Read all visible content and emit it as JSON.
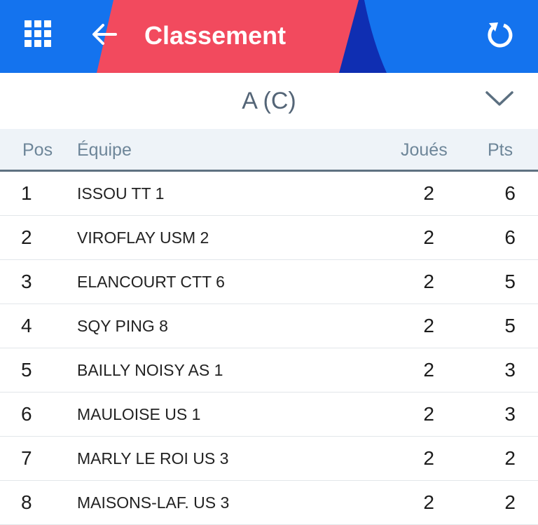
{
  "header": {
    "title": "Classement",
    "background_color": "#1473ee",
    "accent_color": "#f24a5e",
    "menu_icon": "grid-icon",
    "back_icon": "arrow-left-icon",
    "refresh_icon": "refresh-icon"
  },
  "selector": {
    "label": "A (C)",
    "icon": "chevron-down-icon"
  },
  "table": {
    "columns": {
      "pos": "Pos",
      "team": "Équipe",
      "played": "Joués",
      "pts": "Pts"
    },
    "rows": [
      {
        "pos": "1",
        "team": "ISSOU TT 1",
        "played": "2",
        "pts": "6"
      },
      {
        "pos": "2",
        "team": "VIROFLAY USM 2",
        "played": "2",
        "pts": "6"
      },
      {
        "pos": "3",
        "team": "ELANCOURT CTT 6",
        "played": "2",
        "pts": "5"
      },
      {
        "pos": "4",
        "team": "SQY PING 8",
        "played": "2",
        "pts": "5"
      },
      {
        "pos": "5",
        "team": "BAILLY NOISY AS 1",
        "played": "2",
        "pts": "3"
      },
      {
        "pos": "6",
        "team": "MAULOISE US 1",
        "played": "2",
        "pts": "3"
      },
      {
        "pos": "7",
        "team": "MARLY LE ROI US 3",
        "played": "2",
        "pts": "2"
      },
      {
        "pos": "8",
        "team": "MAISONS-LAF. US 3",
        "played": "2",
        "pts": "2"
      }
    ]
  }
}
